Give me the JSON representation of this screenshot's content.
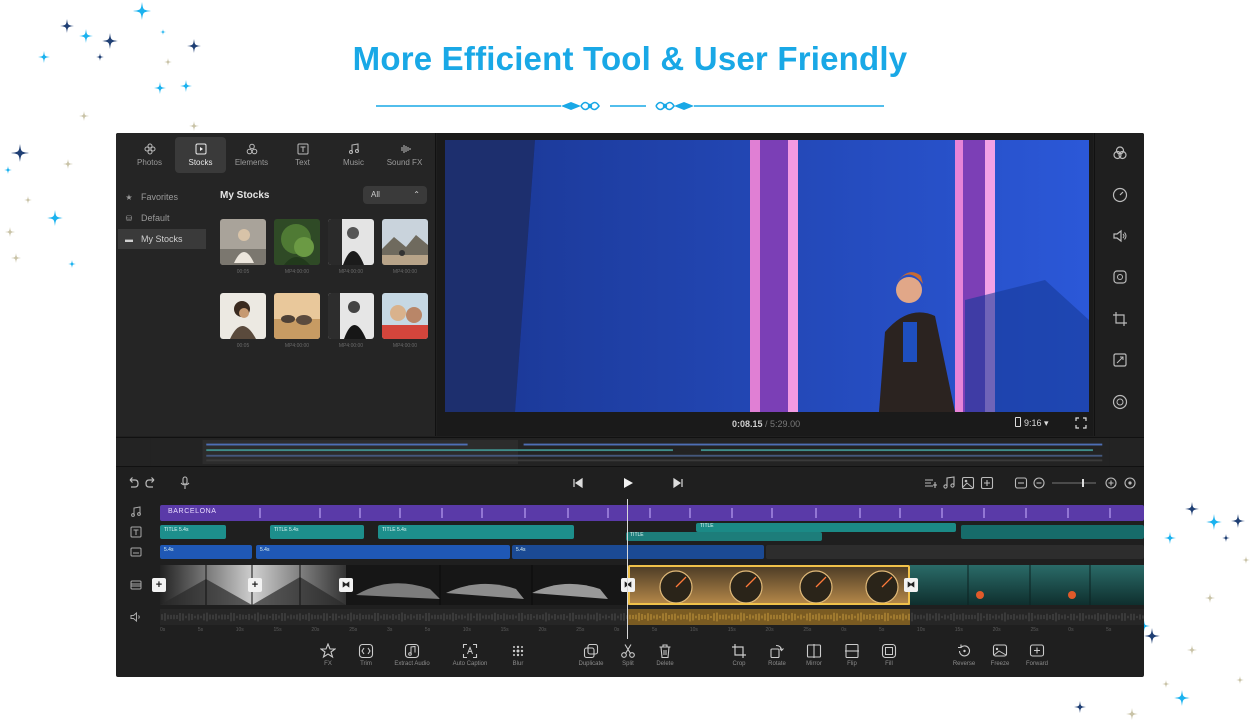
{
  "banner": {
    "title": "More Efficient Tool & User Friendly"
  },
  "colors": {
    "accent": "#19a8e6",
    "sparkle_dark": "#1f3f74",
    "sparkle_light": "#1ab2ef",
    "sparkle_gold": "#c9c3a7",
    "selection": "#f0c14a",
    "audio_track": "#5a3aa8",
    "title_track": "#1d8f8c",
    "text_track": "#1f58b5"
  },
  "media_panel": {
    "tabs": [
      {
        "label": "Photos",
        "icon": "flower-icon"
      },
      {
        "label": "Stocks",
        "icon": "play-square-icon"
      },
      {
        "label": "Elements",
        "icon": "shapes-icon"
      },
      {
        "label": "Text",
        "icon": "text-icon"
      },
      {
        "label": "Music",
        "icon": "music-icon"
      },
      {
        "label": "Sound FX",
        "icon": "soundwave-icon"
      }
    ],
    "active_tab": "Stocks",
    "library": [
      {
        "label": "Favorites",
        "icon": "star-icon"
      },
      {
        "label": "Default",
        "icon": "stack-icon"
      },
      {
        "label": "My Stocks",
        "icon": "folder-icon"
      }
    ],
    "section_title": "My Stocks",
    "filter_value": "All",
    "thumb_captions": [
      "00:05",
      "MP4:00:00",
      "MP4:00:00",
      "MP4:00:00",
      "00:05",
      "MP4:00:00",
      "MP4:00:00",
      "MP4:00:00"
    ]
  },
  "preview": {
    "current_time": "0:08.15",
    "total_time": "/ 5:29.00",
    "aspect_ratio": "9:16 ▾"
  },
  "tools_rail": [
    "color-icon",
    "speed-icon",
    "volume-icon",
    "filter-icon",
    "crop-icon",
    "resize-icon",
    "mask-icon"
  ],
  "timeline": {
    "audio_clip_label": "BARCELONA",
    "title_clips": [
      "TITLE",
      "TITLE",
      "TITLE",
      "TITLE",
      "TITLE"
    ],
    "clip_duration": "5.4s",
    "ruler": [
      "0s",
      "5s",
      "10s",
      "15s",
      "20s",
      "25s",
      "3s",
      "5s",
      "10s",
      "15s",
      "20s",
      "25s",
      "0s",
      "5s",
      "10s",
      "15s",
      "20s",
      "25s",
      "0s",
      "5s",
      "10s",
      "15s",
      "20s",
      "25s",
      "0s",
      "5s"
    ]
  },
  "bottom_tools": [
    {
      "label": "FX",
      "icon": "fx-star-icon"
    },
    {
      "label": "Trim",
      "icon": "trim-icon"
    },
    {
      "label": "Extract Audio",
      "icon": "extract-audio-icon"
    },
    {
      "label": "Auto Caption",
      "icon": "auto-caption-icon"
    },
    {
      "label": "Blur",
      "icon": "blur-icon"
    },
    {
      "label": "Duplicate",
      "icon": "duplicate-icon"
    },
    {
      "label": "Split",
      "icon": "scissors-icon"
    },
    {
      "label": "Delete",
      "icon": "trash-icon"
    },
    {
      "label": "Crop",
      "icon": "crop-icon"
    },
    {
      "label": "Rotate",
      "icon": "rotate-icon"
    },
    {
      "label": "Mirror",
      "icon": "mirror-icon"
    },
    {
      "label": "Flip",
      "icon": "flip-icon"
    },
    {
      "label": "Fill",
      "icon": "fill-icon"
    },
    {
      "label": "Reverse",
      "icon": "reverse-icon"
    },
    {
      "label": "Freeze",
      "icon": "freeze-icon"
    },
    {
      "label": "Forward",
      "icon": "forward-icon"
    }
  ]
}
